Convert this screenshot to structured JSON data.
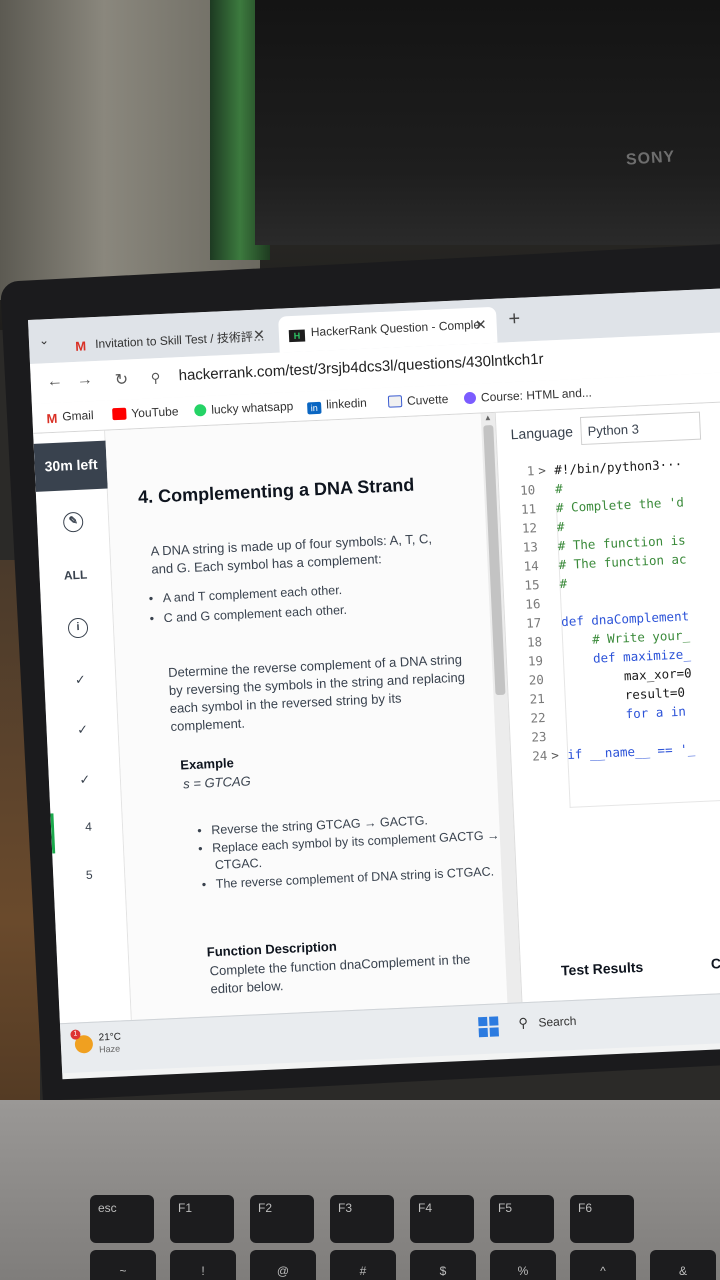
{
  "monitor": {
    "brand": "SONY"
  },
  "browser": {
    "tabs": [
      {
        "label": "Invitation to Skill Test / 技術評…",
        "active": false,
        "icon": "gmail-icon"
      },
      {
        "label": "HackerRank Question - Comple",
        "active": true,
        "icon": "hackerrank-icon"
      }
    ],
    "url": "hackerrank.com/test/3rsjb4dcs3l/questions/430lntkch1r",
    "bookmarks": [
      "Gmail",
      "YouTube",
      "lucky whatsapp",
      "linkedin",
      "Cuvette",
      "Course: HTML and..."
    ]
  },
  "rail": {
    "timer": "30m left",
    "all_label": "ALL",
    "numbers": [
      "4",
      "5"
    ]
  },
  "question": {
    "title": "4. Complementing a DNA Strand",
    "intro_1": "A DNA string is made up of four symbols: A, T, C,",
    "intro_2": "and G. Each symbol has a complement:",
    "bullet_1": "A and T complement each other.",
    "bullet_2": "C and G complement each other.",
    "task_1": "Determine the reverse complement of a DNA string",
    "task_2": "by reversing the symbols in the string and replacing",
    "task_3": "each symbol in the reversed string by its",
    "task_4": "complement.",
    "example_heading": "Example",
    "example_value": "s = GTCAG",
    "step_1": "Reverse the string GTCAG → GACTG.",
    "step_2a": "Replace each symbol by its complement GACTG →",
    "step_2b": "CTGAC.",
    "step_3": "The reverse complement of DNA string is CTGAC.",
    "fd_heading": "Function Description",
    "fd_1": "Complete the function dnaComplement in the",
    "fd_2": "editor below."
  },
  "editor": {
    "language_label": "Language",
    "language_value": "Python 3",
    "lines": [
      {
        "n": "1",
        "fold": ">",
        "text": "#!/bin/python3···",
        "cls": "id"
      },
      {
        "n": "10",
        "fold": "",
        "text": "#",
        "cls": "cmt"
      },
      {
        "n": "11",
        "fold": "",
        "text": "# Complete the 'd",
        "cls": "cmt"
      },
      {
        "n": "12",
        "fold": "",
        "text": "#",
        "cls": "cmt"
      },
      {
        "n": "13",
        "fold": "",
        "text": "# The function is",
        "cls": "cmt"
      },
      {
        "n": "14",
        "fold": "",
        "text": "# The function ac",
        "cls": "cmt"
      },
      {
        "n": "15",
        "fold": "",
        "text": "#",
        "cls": "cmt"
      },
      {
        "n": "16",
        "fold": "",
        "text": "",
        "cls": "id"
      },
      {
        "n": "17",
        "fold": "",
        "text": "def dnaComplement",
        "cls": "kw"
      },
      {
        "n": "18",
        "fold": "",
        "text": "    # Write your_",
        "cls": "cmt"
      },
      {
        "n": "19",
        "fold": "",
        "text": "    def maximize_",
        "cls": "kw"
      },
      {
        "n": "20",
        "fold": "",
        "text": "        max_xor=0",
        "cls": "id"
      },
      {
        "n": "21",
        "fold": "",
        "text": "        result=0",
        "cls": "id"
      },
      {
        "n": "22",
        "fold": "",
        "text": "        for a in",
        "cls": "kw"
      },
      {
        "n": "23",
        "fold": "",
        "text": "",
        "cls": "id"
      },
      {
        "n": "24",
        "fold": ">",
        "text": "if __name__ == '_",
        "cls": "kw"
      }
    ],
    "test_results": "Test Results",
    "custom": "Cus"
  },
  "taskbar": {
    "temp": "21°C",
    "weather": "Haze",
    "badge": "1",
    "search": "Search"
  },
  "keyboard": {
    "row1": [
      "esc",
      "F1",
      "F2",
      "F3",
      "F4",
      "F5",
      "F6"
    ],
    "row2": [
      "~",
      "!",
      "@",
      "#",
      "$",
      "%",
      "^",
      "&"
    ]
  }
}
